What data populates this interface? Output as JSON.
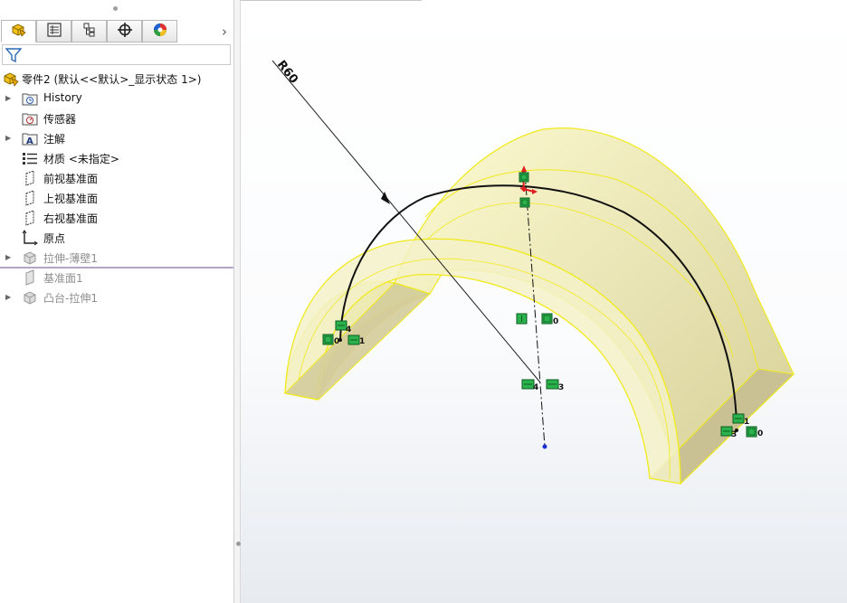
{
  "feature_tree": {
    "tabs": [
      {
        "name": "featuremanager",
        "icon": "featuremanager-icon"
      },
      {
        "name": "propertymanager",
        "icon": "propertymanager-icon"
      },
      {
        "name": "configurationmanager",
        "icon": "configurationmanager-icon"
      },
      {
        "name": "dimxpertmanager",
        "icon": "dimxpert-icon"
      },
      {
        "name": "displaymanager",
        "icon": "displaymanager-icon"
      }
    ],
    "more_glyph": "›",
    "root": {
      "label": "零件2  (默认<<默认>_显示状态 1>)",
      "icon": "part-icon"
    },
    "items": [
      {
        "label": "History",
        "icon": "history-folder-icon",
        "expandable": true,
        "dim": false
      },
      {
        "label": "传感器",
        "icon": "sensor-folder-icon",
        "expandable": false,
        "dim": false
      },
      {
        "label": "注解",
        "icon": "annotation-folder-icon",
        "expandable": true,
        "dim": false
      },
      {
        "label": "材质 <未指定>",
        "icon": "material-icon",
        "expandable": false,
        "dim": false
      },
      {
        "label": "前视基准面",
        "icon": "plane-icon",
        "expandable": false,
        "dim": false
      },
      {
        "label": "上视基准面",
        "icon": "plane-icon",
        "expandable": false,
        "dim": false
      },
      {
        "label": "右视基准面",
        "icon": "plane-icon",
        "expandable": false,
        "dim": false
      },
      {
        "label": "原点",
        "icon": "origin-icon",
        "expandable": false,
        "dim": false
      },
      {
        "label": "拉伸-薄壁1",
        "icon": "extrude-icon",
        "expandable": true,
        "dim": true
      },
      {
        "label": "基准面1",
        "icon": "plane-icon",
        "expandable": false,
        "dim": true
      },
      {
        "label": "凸台-拉伸1",
        "icon": "boss-extrude-icon",
        "expandable": true,
        "dim": true
      }
    ]
  },
  "viewport": {
    "dimension_label": "R60",
    "relation_numbers": {
      "left_top": "4",
      "left_bottom_a": "0",
      "left_bottom_b": "1",
      "center_right": "0",
      "center_low_a": "4",
      "center_low_b": "3",
      "right_top": "1",
      "right_bottom_a": "3",
      "right_bottom_b": "0"
    },
    "colors": {
      "body_fill": "#f1efbd",
      "edge": "#f0ea1c",
      "sketch": "#000000",
      "relation": "#22aa44",
      "center_point": "#1a2fd0",
      "selected": "#e02020"
    }
  }
}
